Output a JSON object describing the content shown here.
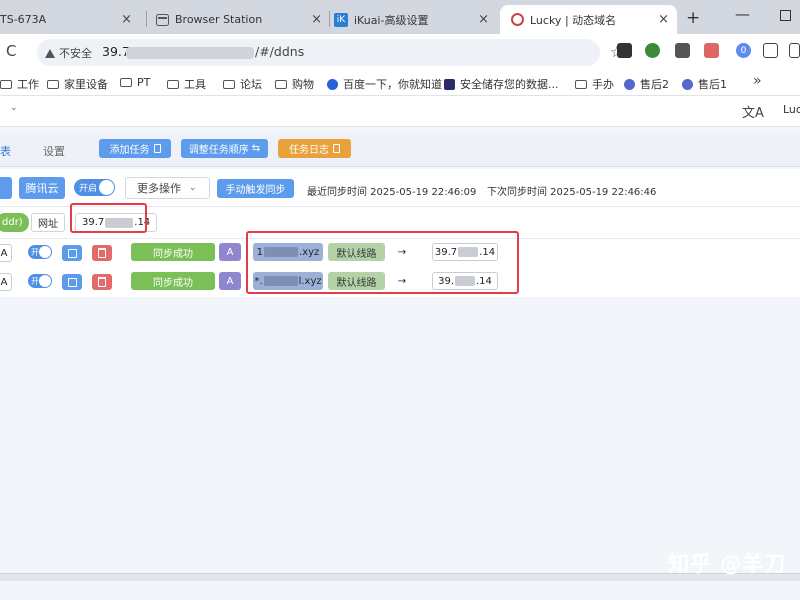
{
  "tabs": [
    {
      "title": "TS-673A",
      "close": "×"
    },
    {
      "title": "Browser Station",
      "close": "×"
    },
    {
      "title": "iKuai-高级设置",
      "close": "×"
    },
    {
      "title": "Lucky | 动态域名",
      "close": "×"
    }
  ],
  "newtab_icon": "+",
  "window": {
    "minimize": "—"
  },
  "address": {
    "insecure_label": "不安全",
    "host": "39.7",
    "path": "/#/ddns",
    "reload_icon": "C",
    "star_icon": "☆"
  },
  "extensions": [
    {
      "name": "extension-1-icon",
      "color": "#333333"
    },
    {
      "name": "extension-2-icon",
      "color": "#3a8a3a"
    },
    {
      "name": "extension-3-icon",
      "color": "#555555"
    },
    {
      "name": "extension-4-icon",
      "color": "#d66"
    },
    {
      "name": "extension-5-icon",
      "color": "#5b8def",
      "badge": "0"
    },
    {
      "name": "puzzle-icon",
      "color": "#444444"
    },
    {
      "name": "sidepanel-icon",
      "color": "#444444"
    }
  ],
  "bookmarks": [
    {
      "label": "工作",
      "icon": "folder"
    },
    {
      "label": "家里设备",
      "icon": "folder"
    },
    {
      "label": "PT",
      "icon": "folder"
    },
    {
      "label": "工具",
      "icon": "folder"
    },
    {
      "label": "论坛",
      "icon": "folder"
    },
    {
      "label": "购物",
      "icon": "folder"
    },
    {
      "label": "百度一下，你就知道",
      "icon": "baidu"
    },
    {
      "label": "安全储存您的数据...",
      "icon": "lock"
    },
    {
      "label": "手办",
      "icon": "folder"
    },
    {
      "label": "售后2",
      "icon": "site"
    },
    {
      "label": "售后1",
      "icon": "site"
    }
  ],
  "bookmarks_more": "»",
  "app_header": {
    "translate_icon": "文A",
    "lang_label": "Luc"
  },
  "page_tabs": {
    "list": "表",
    "settings": "设置"
  },
  "actions": {
    "add_task": "添加任务",
    "adjust_order": "调整任务顺序",
    "task_log": "任务日志"
  },
  "task": {
    "provider": "腾讯云",
    "toggle_label": "开启",
    "more_actions": "更多操作",
    "manual_sync": "手动触发同步",
    "last_sync": "最近同步时间 2025-05-19 22:46:09",
    "next_sync": "下次同步时间 2025-05-19 22:46:46"
  },
  "filter": {
    "addr_chip": "ddr)",
    "url_chip": "网址",
    "ip_prefix": "39.7",
    "ip_suffix": ".14"
  },
  "records": [
    {
      "type": "A",
      "toggle": "开",
      "status": "同步成功",
      "rtype": "A",
      "domain_prefix": "1",
      "domain_suffix": ".xyz",
      "route": "默认线路",
      "arrow": "→",
      "ip_prefix": "39.7",
      "ip_suffix": ".14"
    },
    {
      "type": "A",
      "toggle": "开",
      "status": "同步成功",
      "rtype": "A",
      "domain_prefix": "*.",
      "domain_suffix": "l.xyz",
      "route": "默认线路",
      "arrow": "→",
      "ip_prefix": "39.",
      "ip_suffix": ".14"
    }
  ],
  "watermark": "知乎 @羊刀"
}
